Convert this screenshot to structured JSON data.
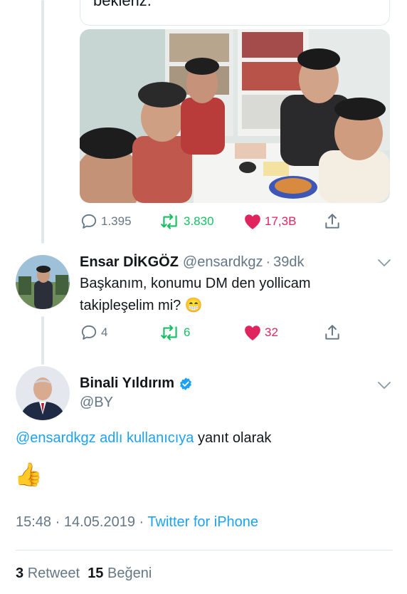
{
  "quoted_tweet": {
    "text_fragment": "bekleriz.",
    "media_alt": "group-selfie-photo",
    "actions": {
      "reply_count": "1.395",
      "retweet_count": "3.830",
      "like_count": "17,3B"
    }
  },
  "reply_tweet": {
    "display_name": "Ensar DİKGÖZ",
    "handle": "@ensardkgz",
    "separator": "·",
    "time": "39dk",
    "text_line1": "Başkanım, konumu DM den yollicam",
    "text_line2": "takipleşelim mi?",
    "emoji": "😁",
    "actions": {
      "reply_count": "4",
      "retweet_count": "6",
      "like_count": "32"
    }
  },
  "main_tweet": {
    "display_name": "Binali Yıldırım",
    "verified": true,
    "handle": "@BY",
    "reply_to_link": "@ensardkgz adlı kullanıcıya",
    "reply_to_suffix": "yanıt olarak",
    "body_emoji": "👍",
    "time": "15:48",
    "date_separator": "·",
    "date": "14.05.2019",
    "source_separator": "·",
    "source": "Twitter for iPhone",
    "retweet_count": "3",
    "retweet_label": "Retweet",
    "like_count": "15",
    "like_label": "Beğeni"
  },
  "colors": {
    "link_blue": "#1da1f2",
    "retweet_green": "#17bf63",
    "like_red": "#e0245e",
    "secondary_gray": "#657786"
  },
  "icons": [
    "reply-icon",
    "retweet-icon",
    "heart-icon",
    "share-icon",
    "verified-icon",
    "chevron-down-icon"
  ]
}
